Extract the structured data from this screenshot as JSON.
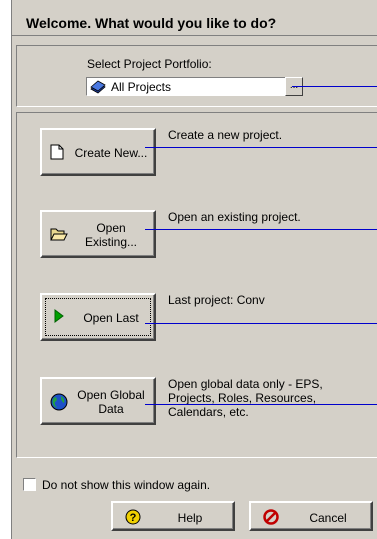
{
  "dialog": {
    "title": "Welcome.  What would you like to do?"
  },
  "portfolio": {
    "label": "Select Project Portfolio:",
    "value": "All Projects",
    "browse_label": "..."
  },
  "actions": [
    {
      "button": "Create New...",
      "description": "Create a new project."
    },
    {
      "button_line1": "Open",
      "button_line2": "Existing...",
      "description": "Open an existing project."
    },
    {
      "button": "Open Last",
      "description": "Last project: Conv"
    },
    {
      "button_line1": "Open Global",
      "button_line2": "Data",
      "description": "Open global data only - EPS, Projects, Roles, Resources, Calendars, etc."
    }
  ],
  "footer": {
    "checkbox_label": "Do not show this window again.",
    "checkbox_checked": false,
    "help_label": "Help",
    "cancel_label": "Cancel"
  },
  "colors": {
    "dialog_bg": "#d4d0c8",
    "callout_line": "#0000cc"
  },
  "icons": {
    "portfolio": "book-icon",
    "create_new": "new-document-icon",
    "open_existing": "open-folder-icon",
    "open_last": "play-arrow-icon",
    "open_global": "globe-icon",
    "help": "help-icon",
    "cancel": "cancel-icon"
  }
}
